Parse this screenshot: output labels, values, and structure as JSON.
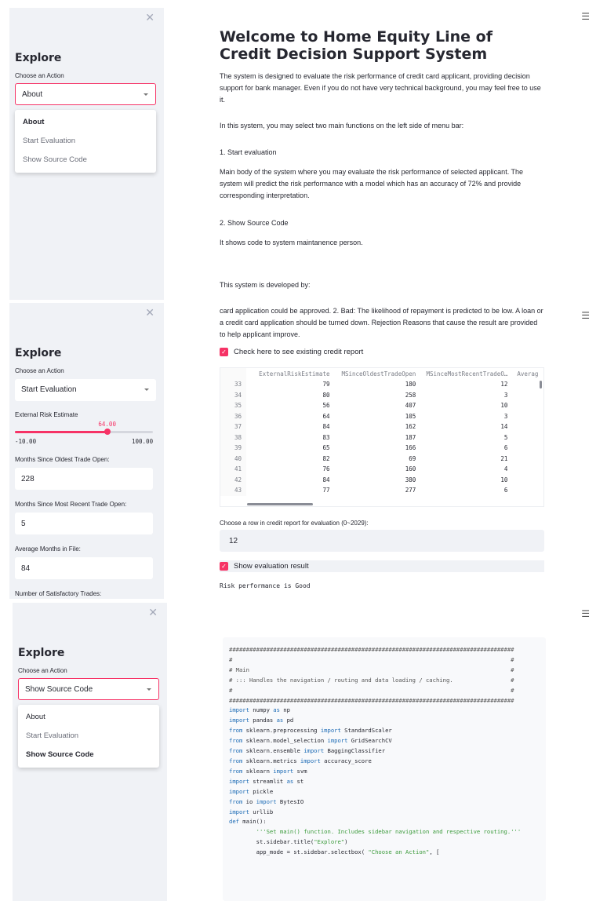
{
  "sidebar": {
    "title": "Explore",
    "action_label": "Choose an Action",
    "options": [
      "About",
      "Start Evaluation",
      "Show Source Code"
    ]
  },
  "panel1": {
    "selected": "About",
    "heading": "Welcome to Home Equity Line of Credit Decision Support System",
    "intro": "The system is designed to evaluate the risk performance of credit card applicant, providing decision support for bank manager. Even if you do not have very technical background, you may feel free to use it.",
    "select_note": "In this system, you may select two main functions on the left side of menu bar:",
    "item1_title": "1.  Start evaluation",
    "item1_body": "Main body of the system where you may evaluate the risk performance of selected applicant. The system will predict the risk performance with a model which has an accuracy of 72% and provide corresponding interpretation.",
    "item2_title": "2.  Show Source Code",
    "item2_body": "It shows code to system maintanence person.",
    "developed_by": "This system is developed by:"
  },
  "panel2": {
    "selected": "Start Evaluation",
    "top_text": "card application could be approved. 2. Bad: The likelihood of repayment is predicted to be low. A loan or a credit card application should be turned down. Rejection Reasons that cause the result are provided to help applicant improve.",
    "check_label": "Check here to see existing credit report",
    "slider_label": "External Risk Estimate",
    "slider_value": "64.00",
    "slider_value_num": 64,
    "slider_min": "-10.00",
    "slider_max": "100.00",
    "slider_min_num": -10,
    "slider_max_num": 100,
    "field1_label": "Months Since Oldest Trade Open:",
    "field1_value": "228",
    "field2_label": "Months Since Most Recent Trade Open:",
    "field2_value": "5",
    "field3_label": "Average Months in File:",
    "field3_value": "84",
    "field4_label": "Number of Satisfactory Trades:",
    "table": {
      "columns": [
        "ExternalRiskEstimate",
        "MSinceOldestTradeOpen",
        "MSinceMostRecentTradeO…",
        "Averag"
      ],
      "rows": [
        [
          "33",
          "79",
          "180",
          "12"
        ],
        [
          "34",
          "80",
          "258",
          "3"
        ],
        [
          "35",
          "56",
          "407",
          "10"
        ],
        [
          "36",
          "64",
          "105",
          "3"
        ],
        [
          "37",
          "84",
          "162",
          "14"
        ],
        [
          "38",
          "83",
          "187",
          "5"
        ],
        [
          "39",
          "65",
          "166",
          "6"
        ],
        [
          "40",
          "82",
          "69",
          "21"
        ],
        [
          "41",
          "76",
          "160",
          "4"
        ],
        [
          "42",
          "84",
          "380",
          "10"
        ],
        [
          "43",
          "77",
          "277",
          "6"
        ]
      ]
    },
    "row_select_label": "Choose a row in credit report for evaluation (0~2029):",
    "row_select_value": "12",
    "show_result_label": "Show evaluation result",
    "result_text": "Risk performance is Good"
  },
  "panel3": {
    "selected": "Show Source Code",
    "code_lines": [
      "####################################################################################",
      "#                                                                                  #",
      "# Main                                                                             #",
      "# ::: Handles the navigation / routing and data loading / caching.                 #",
      "#                                                                                  #",
      "####################################################################################",
      "import numpy as np",
      "import pandas as pd",
      "from sklearn.preprocessing import StandardScaler",
      "from sklearn.model_selection import GridSearchCV",
      "from sklearn.ensemble import BaggingClassifier",
      "from sklearn.metrics import accuracy_score",
      "from sklearn import svm",
      "import streamlit as st",
      "import pickle",
      "from io import BytesIO",
      "import urllib",
      "",
      "",
      "def main():",
      "        '''Set main() function. Includes sidebar navigation and respective routing.'''",
      "",
      "        st.sidebar.title(\"Explore\")",
      "        app_mode = st.sidebar.selectbox( \"Choose an Action\", ["
    ]
  }
}
